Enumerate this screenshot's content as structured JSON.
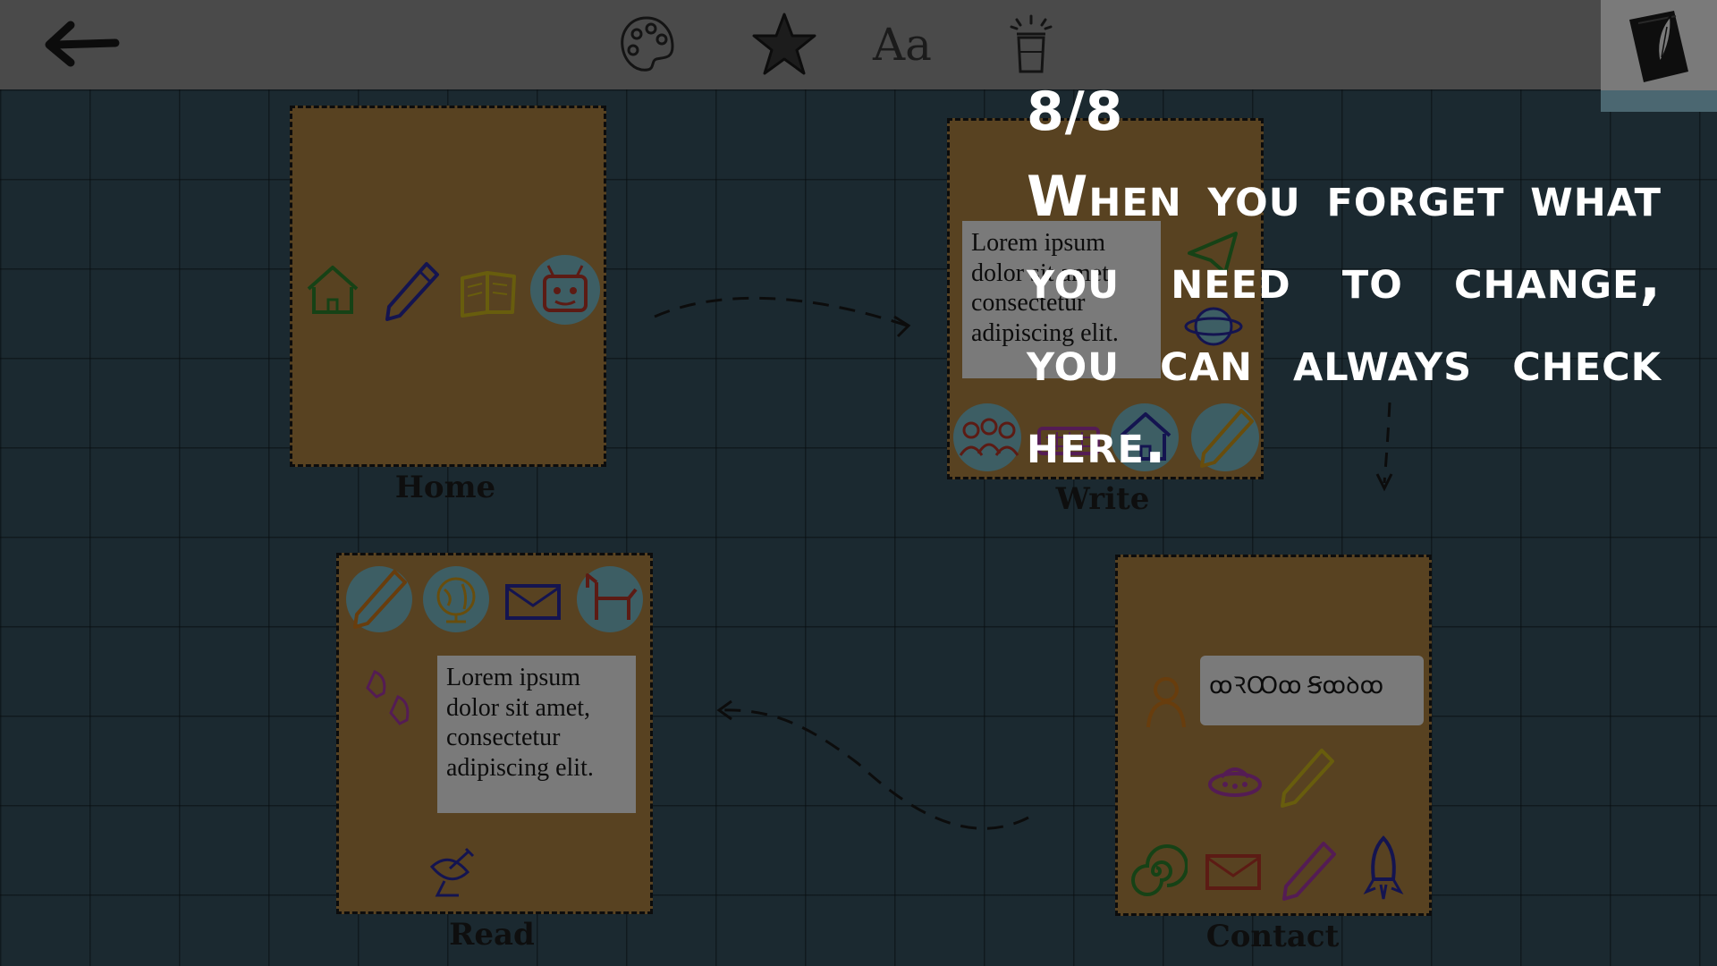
{
  "toolbar": {
    "back_icon": "arrow-left-icon",
    "tools": [
      {
        "icon": "palette-icon"
      },
      {
        "icon": "star-icon"
      },
      {
        "label": "Aa",
        "icon": "font-icon"
      },
      {
        "icon": "jar-light-icon"
      }
    ],
    "notebook_icon": "notebook-quill-icon"
  },
  "pages": {
    "home": {
      "label": "Home",
      "icons": [
        "house-icon",
        "pencil-icon",
        "book-icon",
        "robot-icon"
      ]
    },
    "write": {
      "label": "Write",
      "text": "Lorem ipsum dolor sit amet, consectetur adipiscing elit.",
      "icons": [
        "paper-plane-icon",
        "planet-icon",
        "people-icon",
        "keyboard-icon",
        "house-icon",
        "pen-icon"
      ]
    },
    "read": {
      "label": "Read",
      "text": "Lorem ipsum dolor sit amet, consectetur adipiscing elit.",
      "icons": [
        "pencil-icon",
        "globe-icon",
        "mail-icon",
        "dog-icon",
        "rocket-icon",
        "satellite-icon"
      ]
    },
    "contact": {
      "label": "Contact",
      "input_value": "ꝏꝚꝎꝏ Ꞩꝏꝺꝏ",
      "icons": [
        "person-icon",
        "ufo-icon",
        "pencil-icon",
        "spiral-icon",
        "mail-icon",
        "pencil-icon",
        "rocket-icon"
      ]
    }
  },
  "tutorial": {
    "step": "8/8",
    "message": "When you forget what you need to change, you can always check here."
  },
  "colors": {
    "background": "#3a5764",
    "page": "#b88a45",
    "toolbar": "#9c9c9c",
    "accent": "#9dd7ec"
  }
}
